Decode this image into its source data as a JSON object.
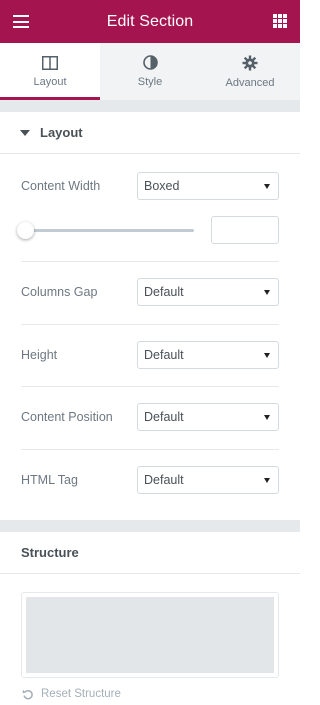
{
  "header": {
    "title": "Edit Section",
    "menu_icon": "hamburger-icon",
    "apps_icon": "grid-icon"
  },
  "tabs": [
    {
      "label": "Layout",
      "icon": "columns-icon",
      "active": true
    },
    {
      "label": "Style",
      "icon": "half-circle-icon",
      "active": false
    },
    {
      "label": "Advanced",
      "icon": "gear-icon",
      "active": false
    }
  ],
  "layout_section": {
    "title": "Layout"
  },
  "controls": {
    "content_width": {
      "label": "Content Width",
      "value": "Boxed",
      "slider_fraction": 0.0,
      "input_value": ""
    },
    "columns_gap": {
      "label": "Columns Gap",
      "value": "Default"
    },
    "height": {
      "label": "Height",
      "value": "Default"
    },
    "content_position": {
      "label": "Content Position",
      "value": "Default"
    },
    "html_tag": {
      "label": "HTML Tag",
      "value": "Default"
    }
  },
  "structure_section": {
    "title": "Structure",
    "reset_label": "Reset Structure",
    "reset_icon": "undo-icon"
  },
  "colors": {
    "brand": "#a4144f",
    "panel_bg": "#f1f3f5",
    "divider": "#e6e9ec",
    "text": "#6d7882",
    "heading": "#495157"
  }
}
